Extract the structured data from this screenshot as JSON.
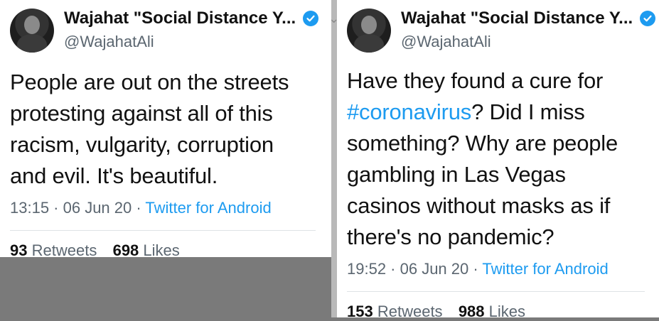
{
  "tweets": [
    {
      "author": {
        "name": "Wajahat \"Social Distance Y...",
        "handle": "@WajahatAli"
      },
      "text": "People are out on the streets protesting against all of this racism, vulgarity, corruption and evil. It's beautiful.",
      "timestamp": "13:15 · 06 Jun 20 · ",
      "source": "Twitter for Android",
      "retweets_count": "93",
      "retweets_label": "Retweets",
      "likes_count": "698",
      "likes_label": "Likes"
    },
    {
      "author": {
        "name": "Wajahat \"Social Distance Y...",
        "handle": "@WajahatAli"
      },
      "text_before_hashtag": "Have they found a cure for ",
      "hashtag": "#coronavirus",
      "text_after_hashtag": "? Did I miss something? Why are people gambling in Las Vegas casinos without masks as if there's no pandemic?",
      "timestamp": "19:52 · 06 Jun 20 · ",
      "source": "Twitter for Android",
      "retweets_count": "153",
      "retweets_label": "Retweets",
      "likes_count": "988",
      "likes_label": "Likes"
    }
  ],
  "colors": {
    "link": "#1d9bf0",
    "text": "#111111",
    "muted": "#5b6670"
  },
  "icons": {
    "verified": "verified-badge-icon",
    "chevron": "chevron-down-icon"
  }
}
